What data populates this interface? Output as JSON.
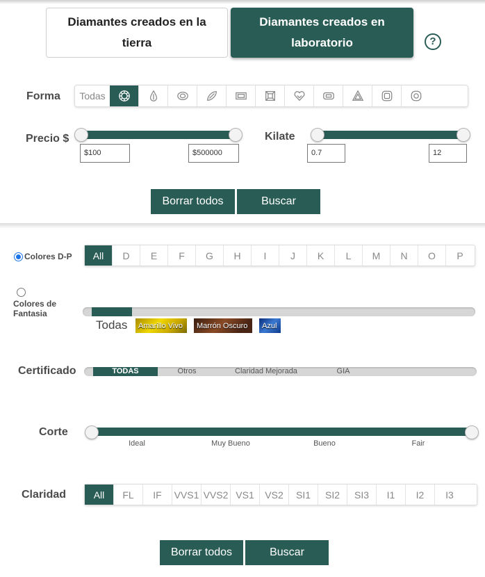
{
  "tabs": {
    "earth_label": "Diamantes creados en la tierra",
    "lab_label": "Diamantes creados en laboratorio",
    "help_symbol": "?"
  },
  "shape": {
    "label": "Forma",
    "all_label": "Todas",
    "items": [
      "round-icon",
      "pear-icon",
      "oval-icon",
      "marquise-icon",
      "emerald-icon",
      "asscher-icon",
      "heart-icon",
      "radiant-icon",
      "trillion-icon",
      "cushion-icon",
      "cushion-round-icon"
    ],
    "selected": "round-icon"
  },
  "price": {
    "label": "Precio $",
    "min_value": "$100",
    "max_value": "$500000"
  },
  "carat": {
    "label": "Kilate",
    "min_value": "0.7",
    "max_value": "12"
  },
  "top_actions": {
    "clear_label": "Borrar todos",
    "search_label": "Buscar"
  },
  "color": {
    "dp_label": "Colores D-P",
    "fancy_label": "Colores de Fantasia",
    "grades": [
      "All",
      "D",
      "E",
      "F",
      "G",
      "H",
      "I",
      "J",
      "K",
      "L",
      "M",
      "N",
      "O",
      "P"
    ],
    "selected": "All"
  },
  "fancy": {
    "all_label": "Todas",
    "chips": [
      "Amarillo Vivo",
      "Marrón Oscuro",
      "Azul"
    ]
  },
  "certificate": {
    "label": "Certificado",
    "options": [
      "TODAS",
      "Otros",
      "Claridad Mejorada",
      "GIA"
    ],
    "selected": "TODAS"
  },
  "cut": {
    "label": "Corte",
    "options": [
      "Ideal",
      "Muy Bueno",
      "Bueno",
      "Fair"
    ]
  },
  "clarity": {
    "label": "Claridad",
    "grades": [
      "All",
      "FL",
      "IF",
      "VVS1",
      "VVS2",
      "VS1",
      "VS2",
      "SI1",
      "SI2",
      "SI3",
      "I1",
      "I2",
      "I3"
    ],
    "selected": "All"
  },
  "bottom_actions": {
    "clear_label": "Borrar todos",
    "search_label": "Buscar"
  },
  "colors": {
    "accent": "#295c55",
    "radio_selected": "#1a73e8"
  }
}
